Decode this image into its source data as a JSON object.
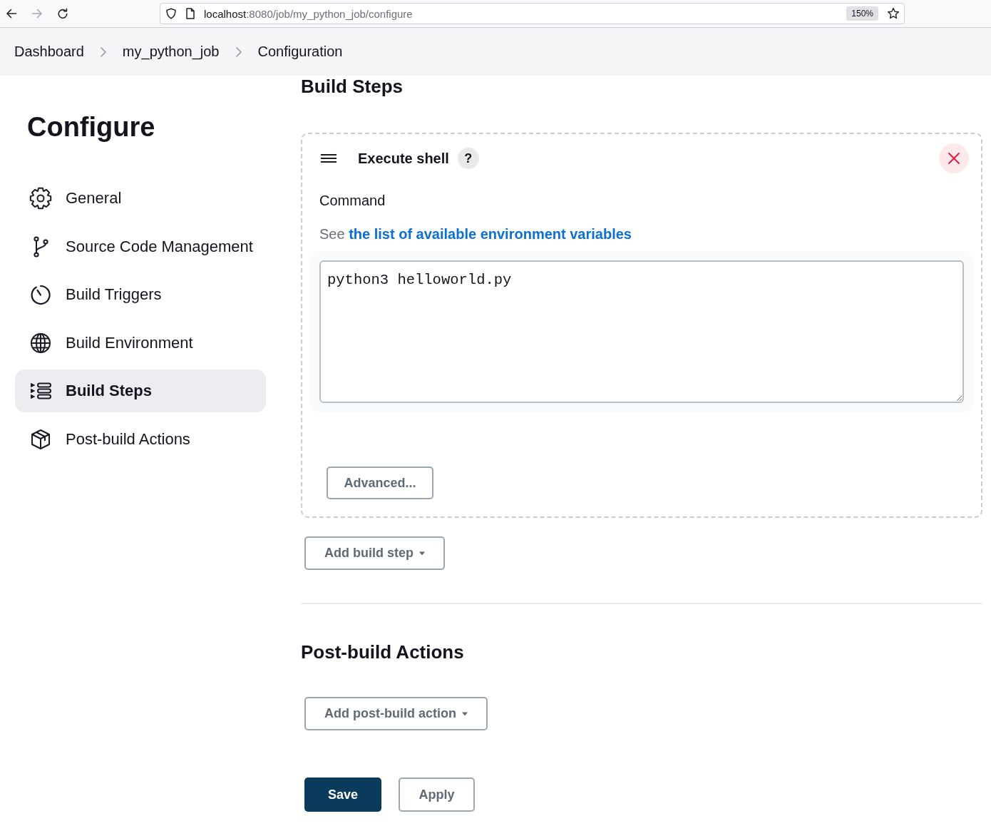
{
  "browser": {
    "nav": [
      {
        "kind": "back",
        "disabled": false
      },
      {
        "kind": "forward",
        "disabled": true
      },
      {
        "kind": "reload",
        "disabled": false
      }
    ],
    "url_host": "localhost",
    "url_rest": ":8080/job/my_python_job/configure",
    "zoom": "150%"
  },
  "breadcrumbs": [
    {
      "label": "Dashboard"
    },
    {
      "label": "my_python_job"
    },
    {
      "label": "Configuration"
    }
  ],
  "sidebar": {
    "title": "Configure",
    "items": [
      {
        "label": "General",
        "selected": false
      },
      {
        "label": "Source Code Management",
        "selected": false
      },
      {
        "label": "Build Triggers",
        "selected": false
      },
      {
        "label": "Build Environment",
        "selected": false
      },
      {
        "label": "Build Steps",
        "selected": true
      },
      {
        "label": "Post-build Actions",
        "selected": false
      }
    ]
  },
  "build_steps": {
    "heading": "Build Steps",
    "steps": [
      {
        "title": "Execute shell",
        "help": "?",
        "field_label": "Command",
        "hint": "See",
        "hint_link": "the list of available environment variables",
        "command": "python3 helloworld.py",
        "advanced_button": "Advanced..."
      }
    ],
    "add_button": "Add build step"
  },
  "post_build": {
    "heading": "Post-build Actions",
    "add_button": "Add post-build action"
  },
  "form_buttons": [
    {
      "label": "Save",
      "kind": "primary"
    },
    {
      "label": "Apply",
      "kind": "secondary"
    }
  ]
}
